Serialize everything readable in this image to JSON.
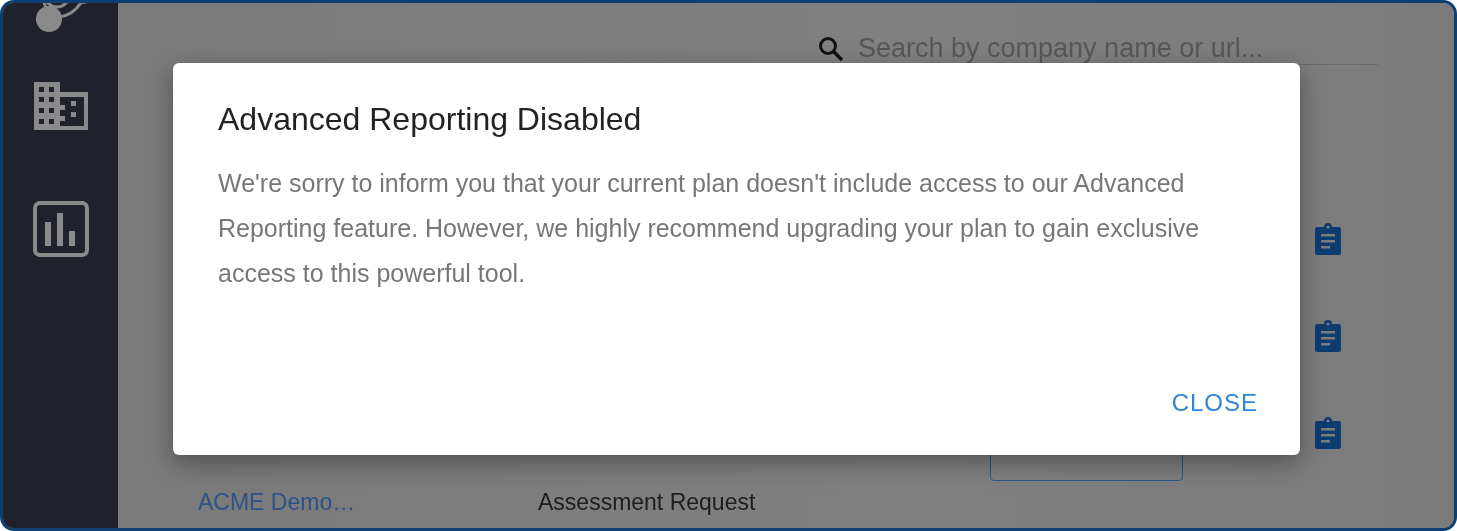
{
  "search": {
    "placeholder": "Search by company name or url..."
  },
  "rows": [
    {
      "name": "",
      "type": "",
      "has_button": false
    },
    {
      "name": "",
      "type": "",
      "has_button": false
    },
    {
      "name": "",
      "type": "",
      "has_button": true
    },
    {
      "name": "ACME Demo…",
      "type": "Assessment Request",
      "has_button": false
    }
  ],
  "dialog": {
    "title": "Advanced Reporting Disabled",
    "body": "We're sorry to inform you that your current plan doesn't include access to our Advanced Reporting feature. However, we highly recommend upgrading your plan to gain exclusive access to this powerful tool.",
    "actions": [
      "CLOSE"
    ]
  }
}
